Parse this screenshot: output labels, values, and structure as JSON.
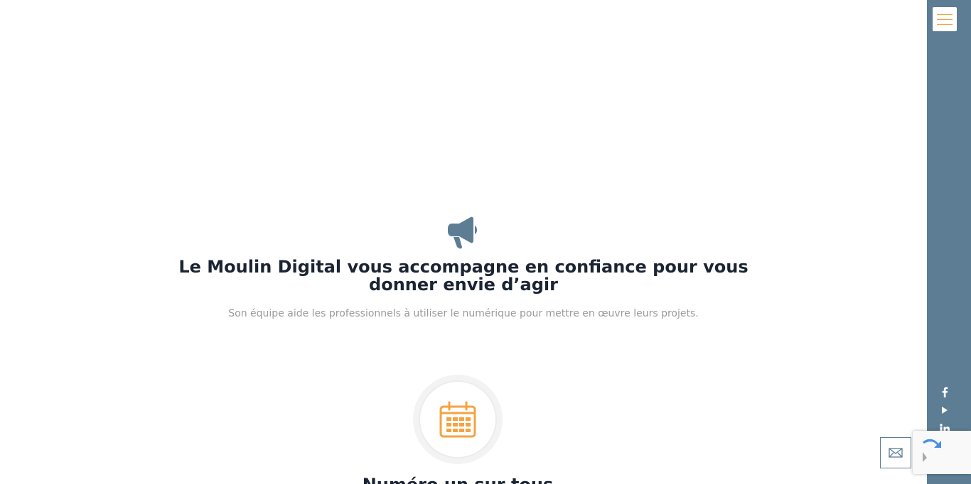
{
  "hero": {
    "icon": "megaphone-icon",
    "headline": "Le Moulin Digital vous accompagne en confiance pour vous donner envie d’agir",
    "subtitle": "Son équipe aide les professionnels à utiliser le numérique pour mettre en œuvre leurs projets."
  },
  "feature": {
    "icon": "calendar-icon",
    "title": "Numéro un sur tous"
  },
  "sidebar": {
    "menu_icon": "hamburger-menu-icon",
    "social": [
      {
        "name": "facebook-icon",
        "glyph": "f"
      },
      {
        "name": "youtube-icon",
        "glyph": "▶"
      },
      {
        "name": "linkedin-icon",
        "glyph": "in"
      },
      {
        "name": "instagram-icon",
        "glyph": ""
      },
      {
        "name": "rss-icon",
        "glyph": ""
      }
    ]
  },
  "contact": {
    "icon": "mail-icon"
  },
  "colors": {
    "sidebar_bg": "#5d7d94",
    "accent": "#f5a340",
    "heading": "#1b2433",
    "muted_text": "#9a9a9a",
    "icon_blue": "#5d7d94"
  }
}
